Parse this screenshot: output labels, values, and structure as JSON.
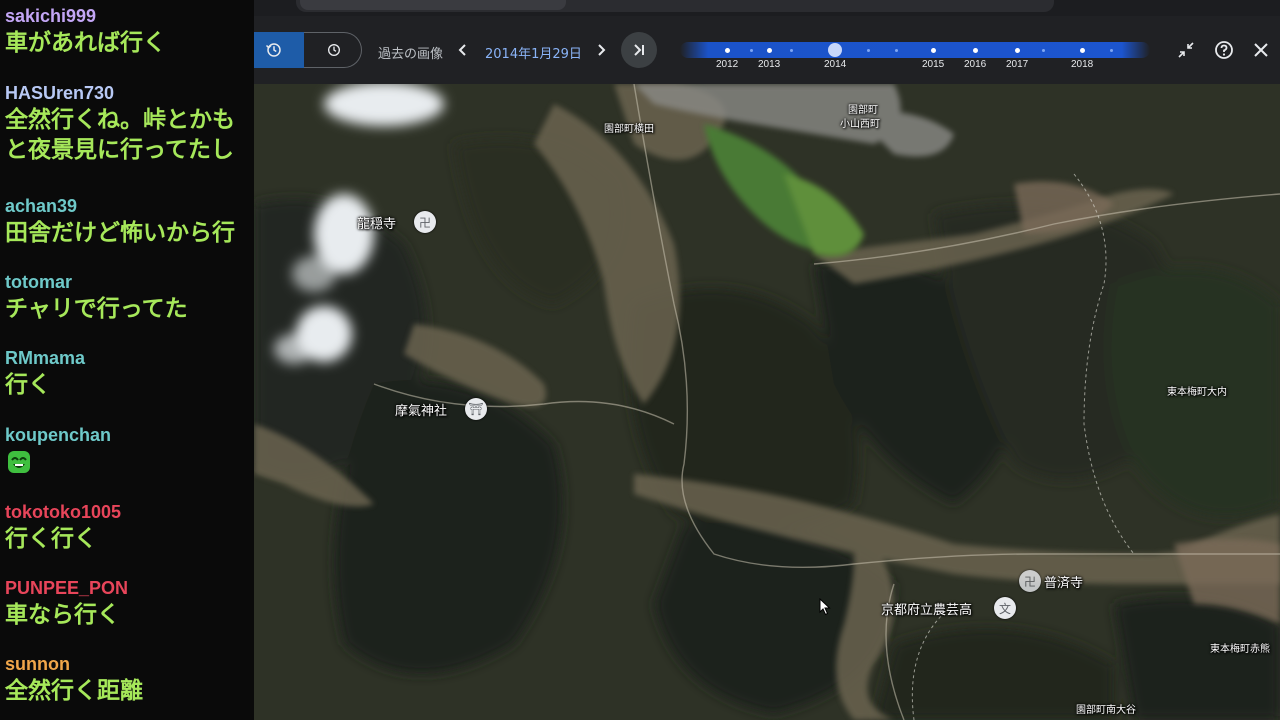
{
  "chat": {
    "messages": [
      {
        "user": "sakichi999",
        "user_color": "#c3a6f5",
        "text": "車があれば行く"
      },
      {
        "user": "HASUren730",
        "user_color": "#b8c9f5",
        "text": "全然行くね。峠とかも"
      },
      {
        "user": "",
        "user_color": "#b8c9f5",
        "text": "と夜景見に行ってたし"
      },
      {
        "user": "achan39",
        "user_color": "#6ec9c9",
        "text": "田舎だけど怖いから行"
      },
      {
        "user": "totomar",
        "user_color": "#6ec9c9",
        "text": "チャリで行ってた"
      },
      {
        "user": "RMmama",
        "user_color": "#6ec9c9",
        "text": "行く"
      },
      {
        "user": "koupenchan",
        "user_color": "#6ec9c9",
        "text": "",
        "emote": "green-face-emote"
      },
      {
        "user": "tokotoko1005",
        "user_color": "#e8455a",
        "text": "行く行く"
      },
      {
        "user": "PUNPEE_PON",
        "user_color": "#e8455a",
        "text": "車なら行く"
      },
      {
        "user": "sunnon",
        "user_color": "#f0a64a",
        "text": "全然行く距離"
      }
    ]
  },
  "history_bar": {
    "label": "過去の画像",
    "date": "2014年1月29日",
    "years": [
      "2012",
      "2013",
      "2014",
      "2015",
      "2016",
      "2017",
      "2018"
    ],
    "selected_year": "2014",
    "icons": {
      "history": "history-icon",
      "time": "clock-icon",
      "prev": "chevron-left-icon",
      "next": "chevron-right-icon",
      "latest": "skip-to-latest-icon",
      "collapse": "collapse-icon",
      "help": "help-icon",
      "close": "close-icon"
    }
  },
  "map": {
    "labels": {
      "sonobe_yokota": "園部町横田",
      "sonobe_koyama": "園部町",
      "sonobe_koyama2": "小山西町",
      "ryuonji": "龍穏寺",
      "maki_jinja": "摩氣神社",
      "higashi_ouchi": "東本梅町大内",
      "fusaiji": "普済寺",
      "nogei": "京都府立農芸高",
      "higashi_akema": "東本梅町赤熊",
      "sonobe_minami": "園部町南大谷"
    }
  },
  "colors": {
    "accent": "#1b53c9",
    "date_blue": "#8ab4f8",
    "chat_text": "#a6e85a"
  }
}
